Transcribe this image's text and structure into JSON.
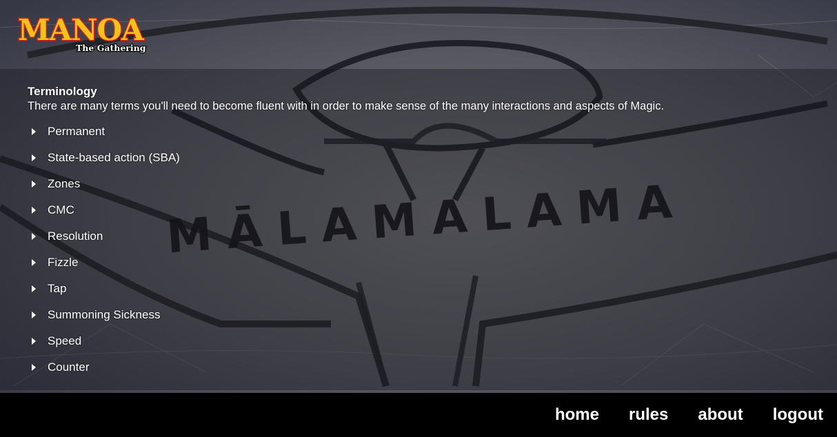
{
  "brand": {
    "logo_word": "MANOA",
    "logo_sub": "The Gathering"
  },
  "background": {
    "engraved_word": "MĀLAMALAMA"
  },
  "terminology": {
    "title": "Terminology",
    "intro": "There are many terms you'll need to become fluent with in order to make sense of the many interactions and aspects of Magic.",
    "items": [
      {
        "label": "Permanent"
      },
      {
        "label": "State-based action (SBA)"
      },
      {
        "label": "Zones"
      },
      {
        "label": "CMC"
      },
      {
        "label": "Resolution"
      },
      {
        "label": "Fizzle"
      },
      {
        "label": "Tap"
      },
      {
        "label": "Summoning Sickness"
      },
      {
        "label": "Speed"
      },
      {
        "label": "Counter"
      }
    ]
  },
  "nav": {
    "home": "home",
    "rules": "rules",
    "about": "about",
    "logout": "logout"
  },
  "colors": {
    "nav_bg": "#000000",
    "text": "#ffffff",
    "logo_red": "#c8201e",
    "logo_gold": "#f4c21a"
  }
}
